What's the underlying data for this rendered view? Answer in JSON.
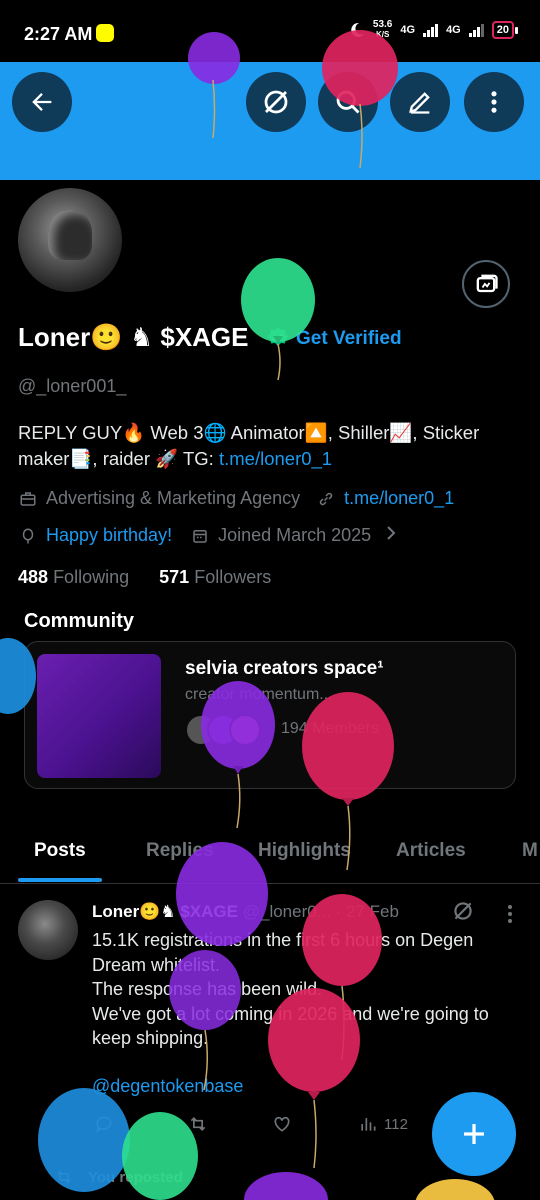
{
  "status_bar": {
    "time": "2:27 AM",
    "net_speed": "53.6",
    "net_unit": "K/S",
    "net1": "4G",
    "net2": "4G",
    "battery": "20"
  },
  "header": {
    "back_icon": "back-arrow-icon",
    "grok_icon": "grok-icon",
    "search_icon": "search-icon",
    "edit_icon": "edit-icon",
    "more_icon": "more-vertical-icon",
    "banner_color": "#1d9bf0"
  },
  "profile": {
    "name": "Loner🙂 ♞ $XAGE",
    "get_verified": "Get Verified",
    "handle": "@_loner001_",
    "bio_text": "REPLY GUY🔥 Web 3🌐 Animator🔼, Shiller📈, Sticker maker📑, raider 🚀 TG: ",
    "bio_link": "t.me/loner0_1",
    "category": "Advertising & Marketing Agency",
    "website": "t.me/loner0_1",
    "birthday": "Happy birthday!",
    "joined": "Joined March 2025",
    "following_count": "488",
    "following_label": "Following",
    "followers_count": "571",
    "followers_label": "Followers"
  },
  "community": {
    "title": "Community",
    "name": "selvia creators space¹",
    "description": "creator momentum...",
    "members": "194 Members"
  },
  "tabs": [
    "Posts",
    "Replies",
    "Highlights",
    "Articles",
    "M"
  ],
  "post": {
    "author": "Loner🙂♞ $XAGE",
    "handle": "@_loner0...",
    "date": "· 27 Feb",
    "text_lines": [
      "15.1K registrations in the first 6 hours on Degen Dream whitelist.",
      "The response has been wild.",
      "We've got a lot coming in 2026 and we're going to keep shipping."
    ],
    "mention": "@degentokenbase",
    "views": "112"
  },
  "repost_notice": "You reposted",
  "colors": {
    "accent": "#1d9bf0",
    "muted": "#71767b",
    "background": "#000000",
    "verified_green": "#00ba7c"
  }
}
